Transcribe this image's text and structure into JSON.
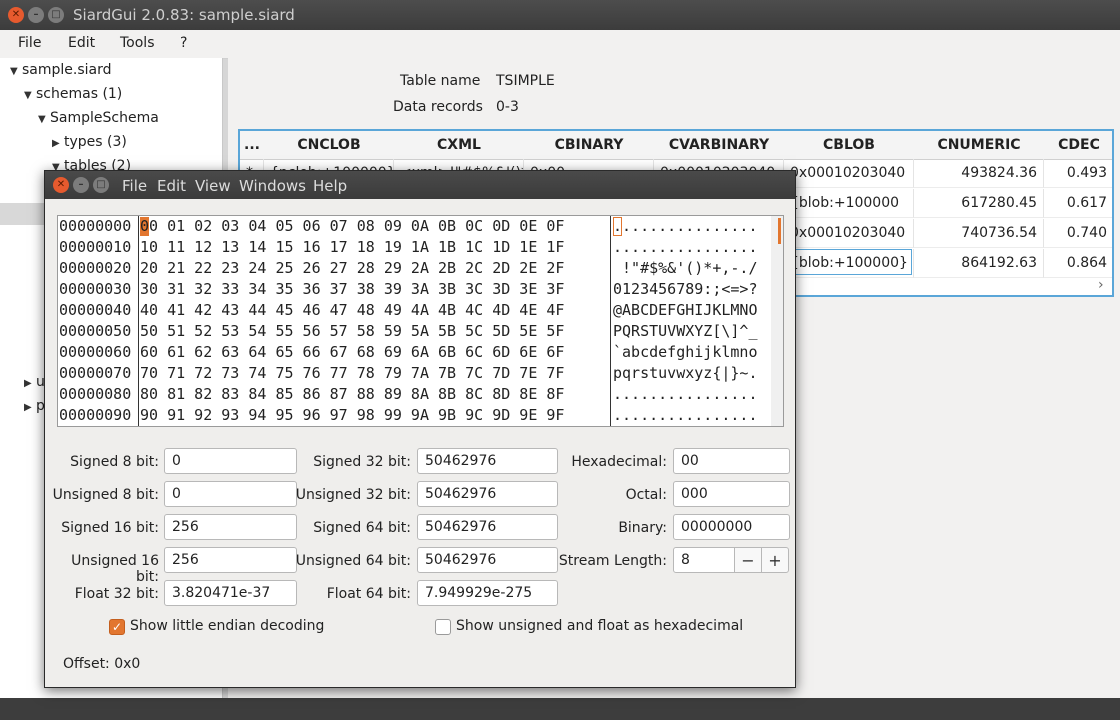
{
  "main_window": {
    "title": "SiardGui 2.0.83: sample.siard",
    "menu": [
      "File",
      "Edit",
      "Tools",
      "?"
    ]
  },
  "tree": {
    "items": [
      {
        "label": "sample.siard",
        "expanded": true
      },
      {
        "label": "schemas (1)",
        "expanded": true
      },
      {
        "label": "SampleSchema",
        "expanded": true
      },
      {
        "label": "types (3)",
        "expanded": false
      },
      {
        "label": "tables (2)",
        "expanded": true
      }
    ],
    "partial_items": [
      "u",
      "p"
    ]
  },
  "table_info": {
    "name_label": "Table name",
    "name_value": "TSIMPLE",
    "records_label": "Data records",
    "records_value": "0-3"
  },
  "grid": {
    "columns": [
      "...",
      "CNCLOB",
      "CXML",
      "CBINARY",
      "CVARBINARY",
      "CBLOB",
      "CNUMERIC",
      "CDEC"
    ],
    "rows": [
      [
        "*",
        "{nclob:+100000}",
        "<xml>!\"#$%&'()*",
        "0x00...",
        "0x00010203040",
        "0x00010203040",
        "493824.36",
        "0.493"
      ],
      [
        "",
        "",
        "",
        "",
        "",
        "{blob:+100000",
        "617280.45",
        "0.617"
      ],
      [
        "",
        "",
        "",
        "",
        "",
        "0x00010203040",
        "740736.54",
        "0.740"
      ],
      [
        "",
        "",
        "",
        "",
        "",
        "{blob:+100000}",
        "864192.63",
        "0.864"
      ]
    ]
  },
  "hex_dialog": {
    "menu": [
      "File",
      "Edit",
      "View",
      "Windows",
      "Help"
    ],
    "rows": [
      {
        "offset": "00000000",
        "bytes": "00 01 02 03 04 05 06 07 08 09 0A 0B 0C 0D 0E 0F",
        "ascii": "................"
      },
      {
        "offset": "00000010",
        "bytes": "10 11 12 13 14 15 16 17 18 19 1A 1B 1C 1D 1E 1F",
        "ascii": "................"
      },
      {
        "offset": "00000020",
        "bytes": "20 21 22 23 24 25 26 27 28 29 2A 2B 2C 2D 2E 2F",
        "ascii": " !\"#$%&'()*+,-./"
      },
      {
        "offset": "00000030",
        "bytes": "30 31 32 33 34 35 36 37 38 39 3A 3B 3C 3D 3E 3F",
        "ascii": "0123456789:;<=>?"
      },
      {
        "offset": "00000040",
        "bytes": "40 41 42 43 44 45 46 47 48 49 4A 4B 4C 4D 4E 4F",
        "ascii": "@ABCDEFGHIJKLMNO"
      },
      {
        "offset": "00000050",
        "bytes": "50 51 52 53 54 55 56 57 58 59 5A 5B 5C 5D 5E 5F",
        "ascii": "PQRSTUVWXYZ[\\]^_"
      },
      {
        "offset": "00000060",
        "bytes": "60 61 62 63 64 65 66 67 68 69 6A 6B 6C 6D 6E 6F",
        "ascii": "`abcdefghijklmno"
      },
      {
        "offset": "00000070",
        "bytes": "70 71 72 73 74 75 76 77 78 79 7A 7B 7C 7D 7E 7F",
        "ascii": "pqrstuvwxyz{|}~."
      },
      {
        "offset": "00000080",
        "bytes": "80 81 82 83 84 85 86 87 88 89 8A 8B 8C 8D 8E 8F",
        "ascii": "................"
      },
      {
        "offset": "00000090",
        "bytes": "90 91 92 93 94 95 96 97 98 99 9A 9B 9C 9D 9E 9F",
        "ascii": "................"
      }
    ],
    "fields": {
      "signed8": {
        "label": "Signed 8 bit:",
        "value": "0"
      },
      "unsigned8": {
        "label": "Unsigned 8 bit:",
        "value": "0"
      },
      "signed16": {
        "label": "Signed 16 bit:",
        "value": "256"
      },
      "unsigned16": {
        "label": "Unsigned 16 bit:",
        "value": "256"
      },
      "float32": {
        "label": "Float 32 bit:",
        "value": "3.820471e-37"
      },
      "signed32": {
        "label": "Signed 32 bit:",
        "value": "50462976"
      },
      "unsigned32": {
        "label": "Unsigned 32 bit:",
        "value": "50462976"
      },
      "signed64": {
        "label": "Signed 64 bit:",
        "value": "50462976"
      },
      "unsigned64": {
        "label": "Unsigned 64 bit:",
        "value": "50462976"
      },
      "float64": {
        "label": "Float 64 bit:",
        "value": "7.949929e-275"
      },
      "hexadecimal": {
        "label": "Hexadecimal:",
        "value": "00"
      },
      "octal": {
        "label": "Octal:",
        "value": "000"
      },
      "binary": {
        "label": "Binary:",
        "value": "00000000"
      },
      "stream_length": {
        "label": "Stream Length:",
        "value": "8"
      }
    },
    "stepper": {
      "minus": "−",
      "plus": "+"
    },
    "checkbox_little_endian": {
      "label": "Show little endian decoding",
      "checked": true
    },
    "checkbox_unsigned_hex": {
      "label": "Show unsigned and float as hexadecimal",
      "checked": false
    },
    "offset_text": "Offset: 0x0"
  },
  "colors": {
    "accent": "#e2762f",
    "selection_border": "#5aa6d8",
    "titlebar": "#3c3c3c"
  }
}
